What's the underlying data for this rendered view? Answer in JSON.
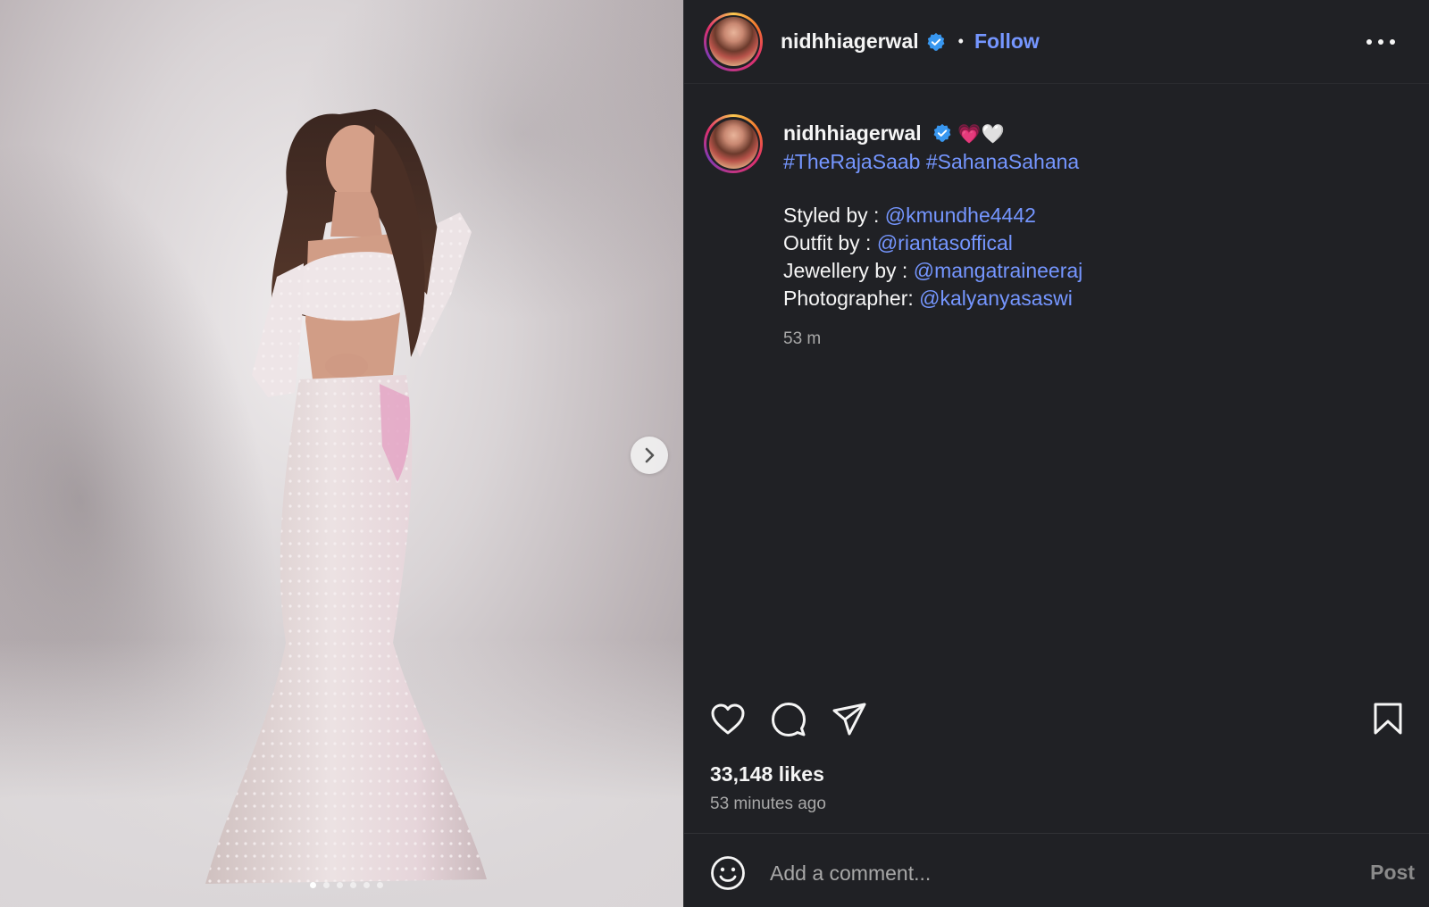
{
  "post": {
    "username": "nidhhiagerwal",
    "follow_label": "Follow",
    "separator": "•",
    "caption": {
      "username": "nidhhiagerwal",
      "emojis": "💗🤍",
      "hashtags": "#TheRajaSaab #SahanaSahana",
      "credits": [
        {
          "label": "Styled by : ",
          "handle": "@kmundhe4442"
        },
        {
          "label": "Outfit by : ",
          "handle": "@riantasoffical"
        },
        {
          "label": "Jewellery by : ",
          "handle": "@mangatraineeraj"
        },
        {
          "label": "Photographer: ",
          "handle": "@kalyanyasaswi"
        }
      ],
      "time": "53 m"
    },
    "likes": "33,148 likes",
    "posted_ago": "53 minutes ago",
    "comment": {
      "placeholder": "Add a comment...",
      "post_label": "Post"
    },
    "carousel": {
      "total": 6,
      "active_index": 0
    }
  },
  "colors": {
    "background": "#202125",
    "link": "#7596ff",
    "muted": "#a8a8a8",
    "verified": "#3897f0"
  },
  "icons": {
    "verified": "verified-badge-icon",
    "more": "more-options-icon",
    "next": "chevron-right-icon",
    "like": "heart-icon",
    "comment": "comment-icon",
    "share": "share-icon",
    "save": "bookmark-icon",
    "emoji": "emoji-icon"
  }
}
